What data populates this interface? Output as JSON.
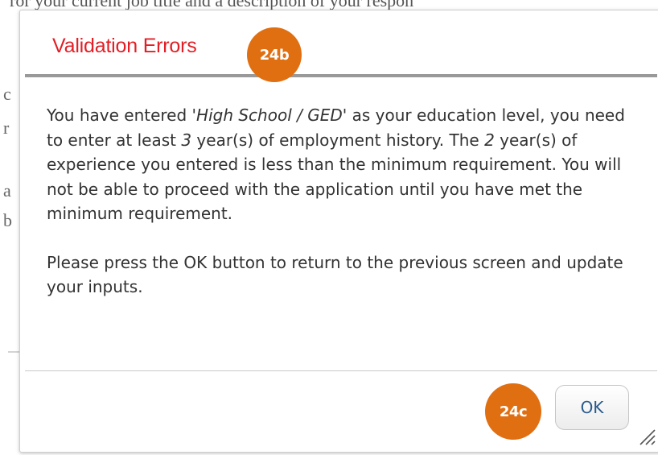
{
  "background": {
    "top_text": "ror your current job title and a description of your respon",
    "fragments": [
      "c",
      "r",
      "a",
      "b"
    ]
  },
  "dialog": {
    "title": "Validation Errors",
    "body": {
      "p1_a": "You have entered '",
      "p1_education": "High School / GED",
      "p1_b": "' as your education level, you need to enter at least ",
      "p1_min_years": "3",
      "p1_c": " year(s) of employment history. The ",
      "p1_entered_years": "2",
      "p1_d": " year(s) of experience you entered is less than the minimum requirement. You will not be able to proceed with the application until you have met the minimum requirement.",
      "p2": "Please press the OK button to return to the previous screen and update your inputs."
    },
    "ok_label": "OK",
    "resize_icon": "resize-grip-icon"
  },
  "callouts": {
    "title_marker": "24b",
    "ok_marker": "24c",
    "color": "#e06f12"
  },
  "colors": {
    "title": "#e21f26",
    "body_text": "#333333",
    "ok_text": "#2a5a8c"
  }
}
